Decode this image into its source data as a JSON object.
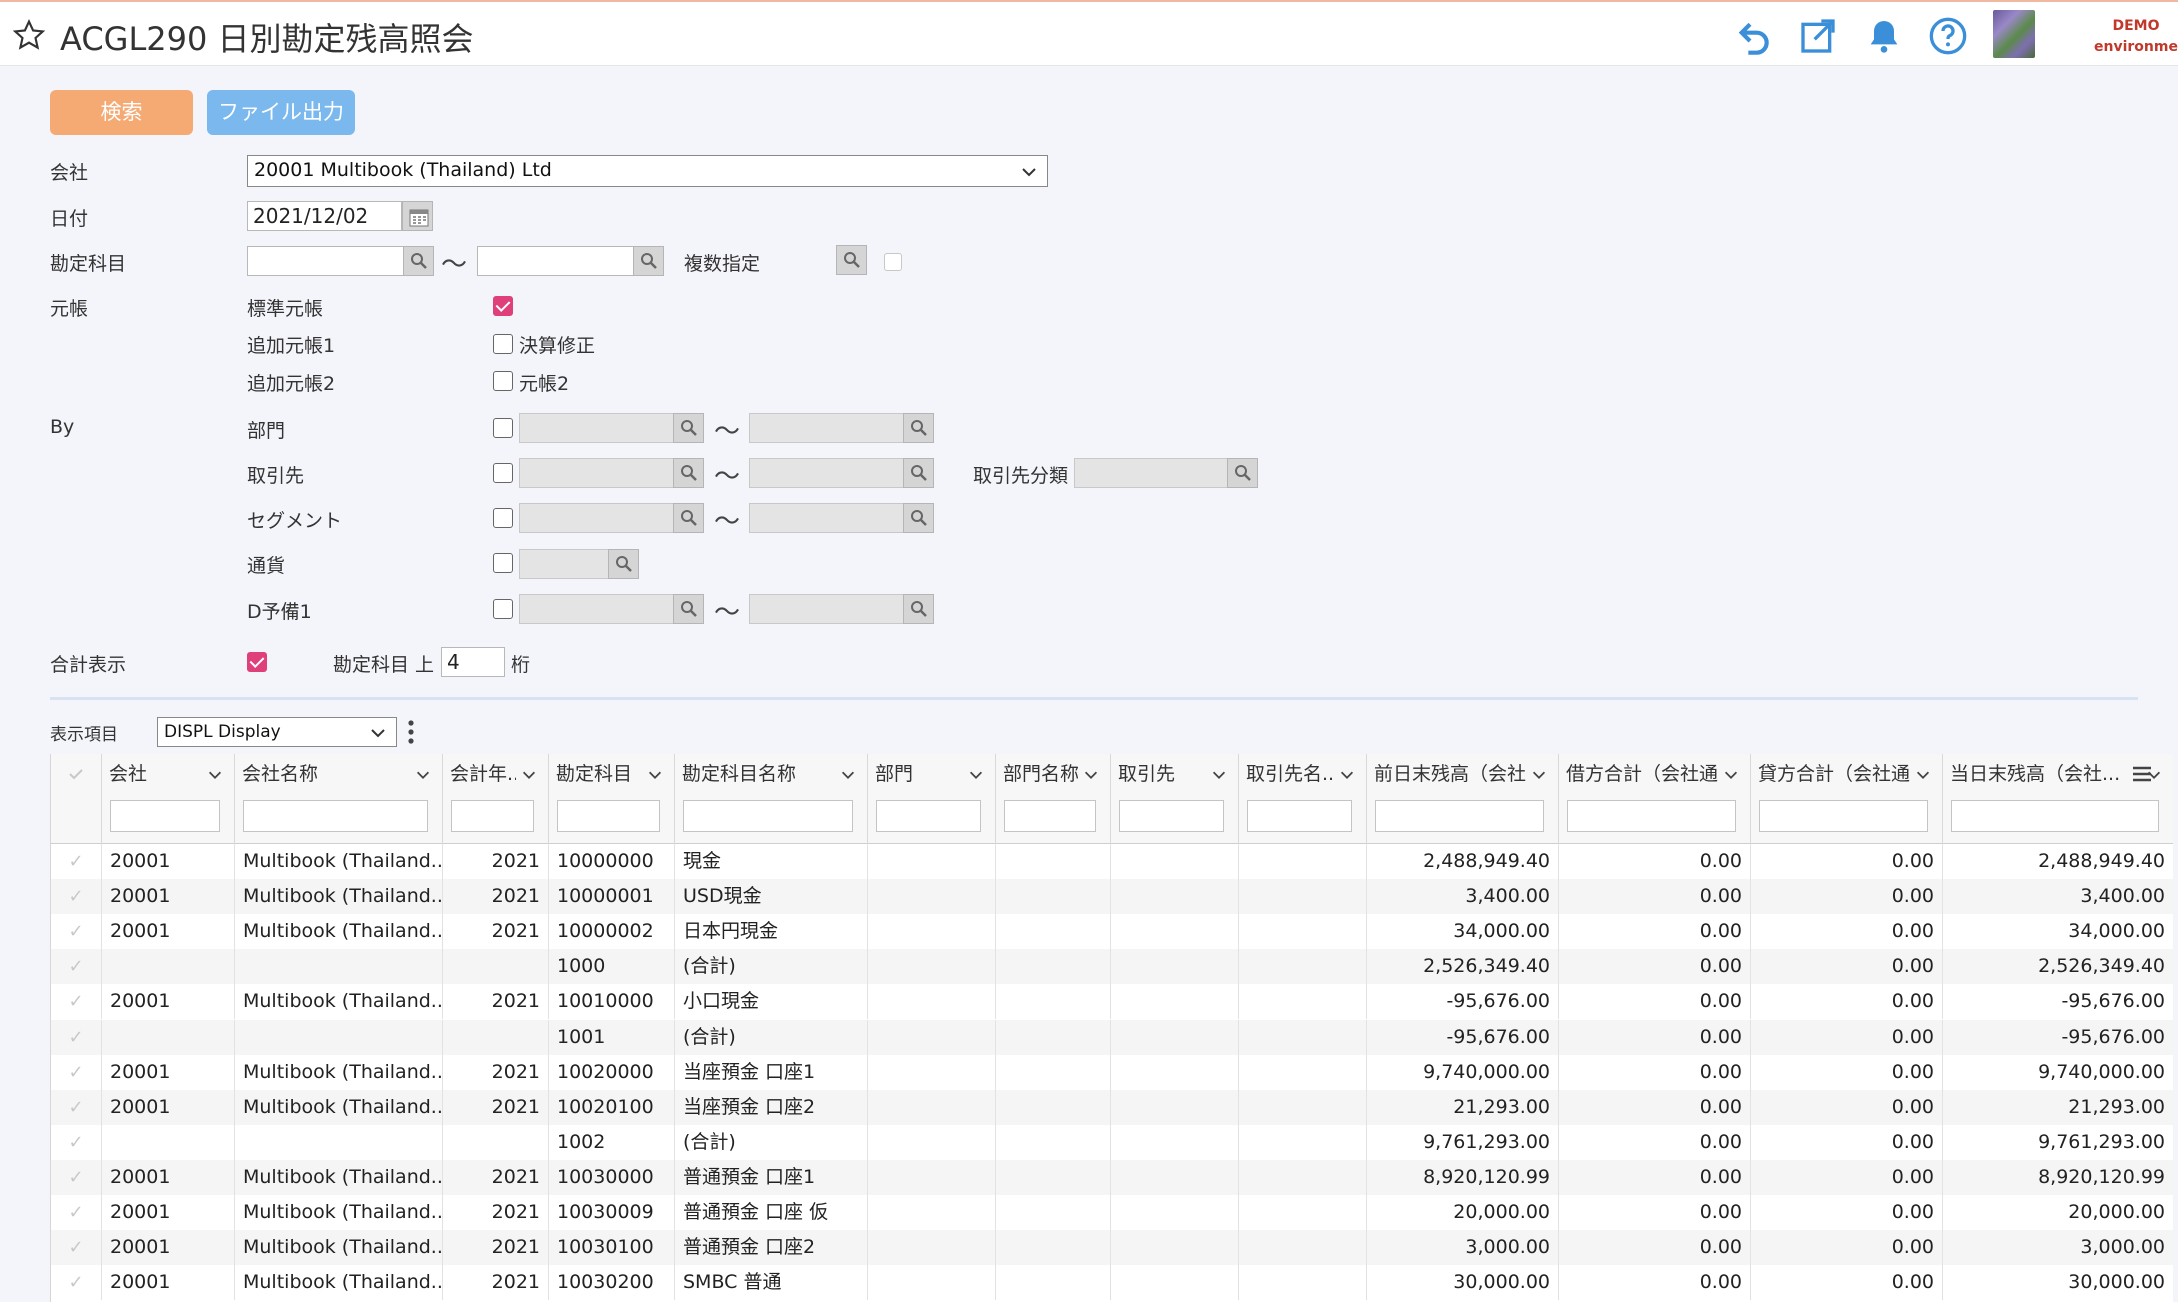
{
  "header": {
    "title": "ACGL290 日別勘定残高照会",
    "env_line1": "DEMO",
    "env_line2": "environment"
  },
  "toolbar": {
    "search_label": "検索",
    "export_label": "ファイル出力"
  },
  "form": {
    "company_label": "会社",
    "company_value": "20001 Multibook (Thailand) Ltd",
    "date_label": "日付",
    "date_value": "2021/12/02",
    "account_label": "勘定科目",
    "multi_label": "複数指定",
    "ledger_label": "元帳",
    "ledger_std": "標準元帳",
    "ledger_add1": "追加元帳1",
    "ledger_add2": "追加元帳2",
    "closing_adj": "決算修正",
    "ledger2": "元帳2",
    "by_label": "By",
    "dept": "部門",
    "partner": "取引先",
    "partner_class": "取引先分類",
    "segment": "セグメント",
    "currency": "通貨",
    "dspare1": "D予備1",
    "total_label": "合計表示",
    "account_upper": "勘定科目 上",
    "digits_value": "4",
    "digits_unit": "桁",
    "tilde": "〜",
    "states": {
      "std_ledger": true,
      "total_display": true
    }
  },
  "grid": {
    "display_label": "表示項目",
    "display_value": "DISPL Display",
    "columns": [
      "会社",
      "会社名称",
      "会計年...",
      "勘定科目",
      "勘定科目名称",
      "部門",
      "部門名称...",
      "取引先",
      "取引先名...",
      "前日末残高（会社...",
      "借方合計（会社通...",
      "貸方合計（会社通...",
      "当日末残高（会社..."
    ],
    "rows": [
      [
        "20001",
        "Multibook (Thailand...",
        "2021",
        "10000000",
        "現金",
        "",
        "",
        "",
        "",
        "2,488,949.40",
        "0.00",
        "0.00",
        "2,488,949.40"
      ],
      [
        "20001",
        "Multibook (Thailand...",
        "2021",
        "10000001",
        "USD現金",
        "",
        "",
        "",
        "",
        "3,400.00",
        "0.00",
        "0.00",
        "3,400.00"
      ],
      [
        "20001",
        "Multibook (Thailand...",
        "2021",
        "10000002",
        "日本円現金",
        "",
        "",
        "",
        "",
        "34,000.00",
        "0.00",
        "0.00",
        "34,000.00"
      ],
      [
        "",
        "",
        "",
        "1000",
        "(合計)",
        "",
        "",
        "",
        "",
        "2,526,349.40",
        "0.00",
        "0.00",
        "2,526,349.40"
      ],
      [
        "20001",
        "Multibook (Thailand...",
        "2021",
        "10010000",
        "小口現金",
        "",
        "",
        "",
        "",
        "-95,676.00",
        "0.00",
        "0.00",
        "-95,676.00"
      ],
      [
        "",
        "",
        "",
        "1001",
        "(合計)",
        "",
        "",
        "",
        "",
        "-95,676.00",
        "0.00",
        "0.00",
        "-95,676.00"
      ],
      [
        "20001",
        "Multibook (Thailand...",
        "2021",
        "10020000",
        "当座預金 口座1",
        "",
        "",
        "",
        "",
        "9,740,000.00",
        "0.00",
        "0.00",
        "9,740,000.00"
      ],
      [
        "20001",
        "Multibook (Thailand...",
        "2021",
        "10020100",
        "当座預金 口座2",
        "",
        "",
        "",
        "",
        "21,293.00",
        "0.00",
        "0.00",
        "21,293.00"
      ],
      [
        "",
        "",
        "",
        "1002",
        "(合計)",
        "",
        "",
        "",
        "",
        "9,761,293.00",
        "0.00",
        "0.00",
        "9,761,293.00"
      ],
      [
        "20001",
        "Multibook (Thailand...",
        "2021",
        "10030000",
        "普通預金 口座1",
        "",
        "",
        "",
        "",
        "8,920,120.99",
        "0.00",
        "0.00",
        "8,920,120.99"
      ],
      [
        "20001",
        "Multibook (Thailand...",
        "2021",
        "10030009",
        "普通預金 口座 仮",
        "",
        "",
        "",
        "",
        "20,000.00",
        "0.00",
        "0.00",
        "20,000.00"
      ],
      [
        "20001",
        "Multibook (Thailand...",
        "2021",
        "10030100",
        "普通預金 口座2",
        "",
        "",
        "",
        "",
        "3,000.00",
        "0.00",
        "0.00",
        "3,000.00"
      ],
      [
        "20001",
        "Multibook (Thailand...",
        "2021",
        "10030200",
        "SMBC 普通",
        "",
        "",
        "",
        "",
        "30,000.00",
        "0.00",
        "0.00",
        "30,000.00"
      ]
    ]
  },
  "icons": [
    "star-icon",
    "undo-icon",
    "external-link-icon",
    "bell-icon",
    "help-icon",
    "calendar-icon",
    "search-icon",
    "chevron-down-icon",
    "kebab-menu-icon",
    "hamburger-menu-icon"
  ],
  "colors": {
    "search_button": "#f5a973",
    "export_button": "#7ab8ee",
    "checkbox_on": "#e0407a",
    "icon_blue": "#3a8fd8",
    "env_text": "#c0392b"
  }
}
